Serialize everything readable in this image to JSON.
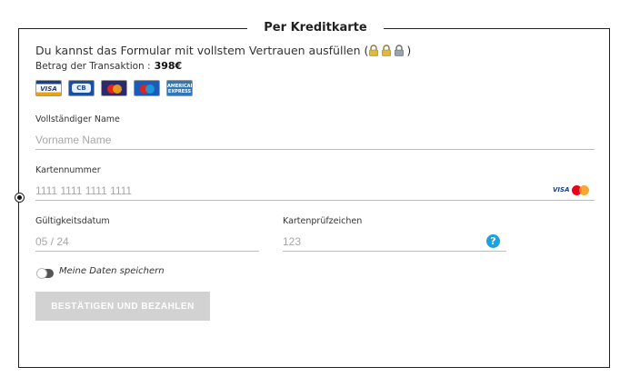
{
  "section_title": "Per Kreditkarte",
  "intro_text": "Du kannst das Formular mit vollstem Vertrauen ausfüllen (",
  "intro_close": ")",
  "amount_label": "Betrag der Transaktion :",
  "amount_value": "398€",
  "card_logos": [
    {
      "name": "visa",
      "text": "VISA"
    },
    {
      "name": "cb",
      "text": "CB"
    },
    {
      "name": "mastercard",
      "text": ""
    },
    {
      "name": "maestro",
      "text": ""
    },
    {
      "name": "american-express",
      "text": "AMERICAN EXPRESS"
    }
  ],
  "fields": {
    "name": {
      "label": "Vollständiger Name",
      "placeholder": "Vorname Name",
      "value": ""
    },
    "card_number": {
      "label": "Kartennummer",
      "placeholder": "1111 1111 1111 1111",
      "value": ""
    },
    "expiry": {
      "label": "Gültigkeitsdatum",
      "placeholder": "05 / 24",
      "value": ""
    },
    "cvc": {
      "label": "Kartenprüfzeichen",
      "placeholder": "123",
      "value": ""
    }
  },
  "brand_badge": {
    "visa": "VISA"
  },
  "help_icon": "?",
  "save_toggle": {
    "label": "Meine Daten speichern",
    "on": false
  },
  "submit_label": "BESTÄTIGEN UND BEZAHLEN",
  "colors": {
    "help": "#1ba1e2",
    "button_disabled": "#d2d2d2"
  }
}
